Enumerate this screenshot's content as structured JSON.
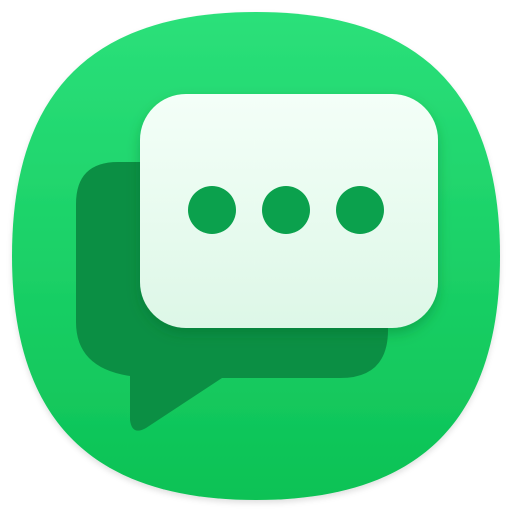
{
  "app_icon": {
    "icon_name": "chat-bubbles-icon",
    "colors": {
      "background_top": "#2BE07A",
      "background_bottom": "#0CC255",
      "back_bubble": "#0B8F44",
      "front_bubble_top": "#F4FFF8",
      "front_bubble_bottom": "#DDF7E7",
      "dots": "#0BA14D"
    },
    "typing_dots_count": 3
  }
}
